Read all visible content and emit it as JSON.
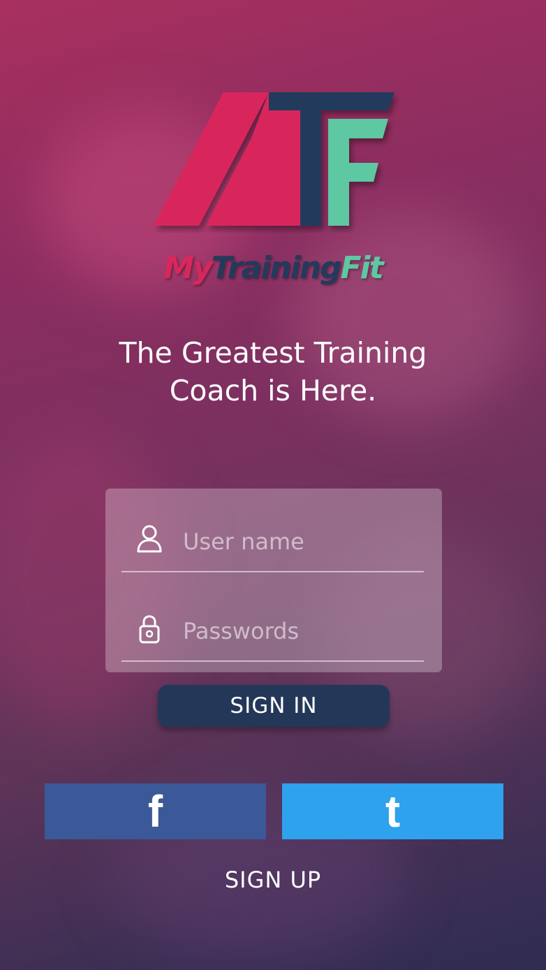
{
  "brand": {
    "logo_letters": "MTF",
    "name_part1": "My",
    "name_part2": "Training",
    "name_part3": "Fit",
    "colors": {
      "pink": "#d8275c",
      "navy": "#243a5c",
      "mint": "#5dc8a2"
    }
  },
  "tagline": {
    "line1": "The Greatest Training",
    "line2": "Coach is Here."
  },
  "login": {
    "username_placeholder": "User name",
    "password_placeholder": "Passwords",
    "username_icon": "user-icon",
    "password_icon": "lock-icon",
    "signin_label": "SIGN IN"
  },
  "social": {
    "facebook_glyph": "f",
    "facebook_color": "#3b5998",
    "tumblr_glyph": "t",
    "tumblr_color": "#2ea2ec"
  },
  "signup_label": "SIGN UP"
}
